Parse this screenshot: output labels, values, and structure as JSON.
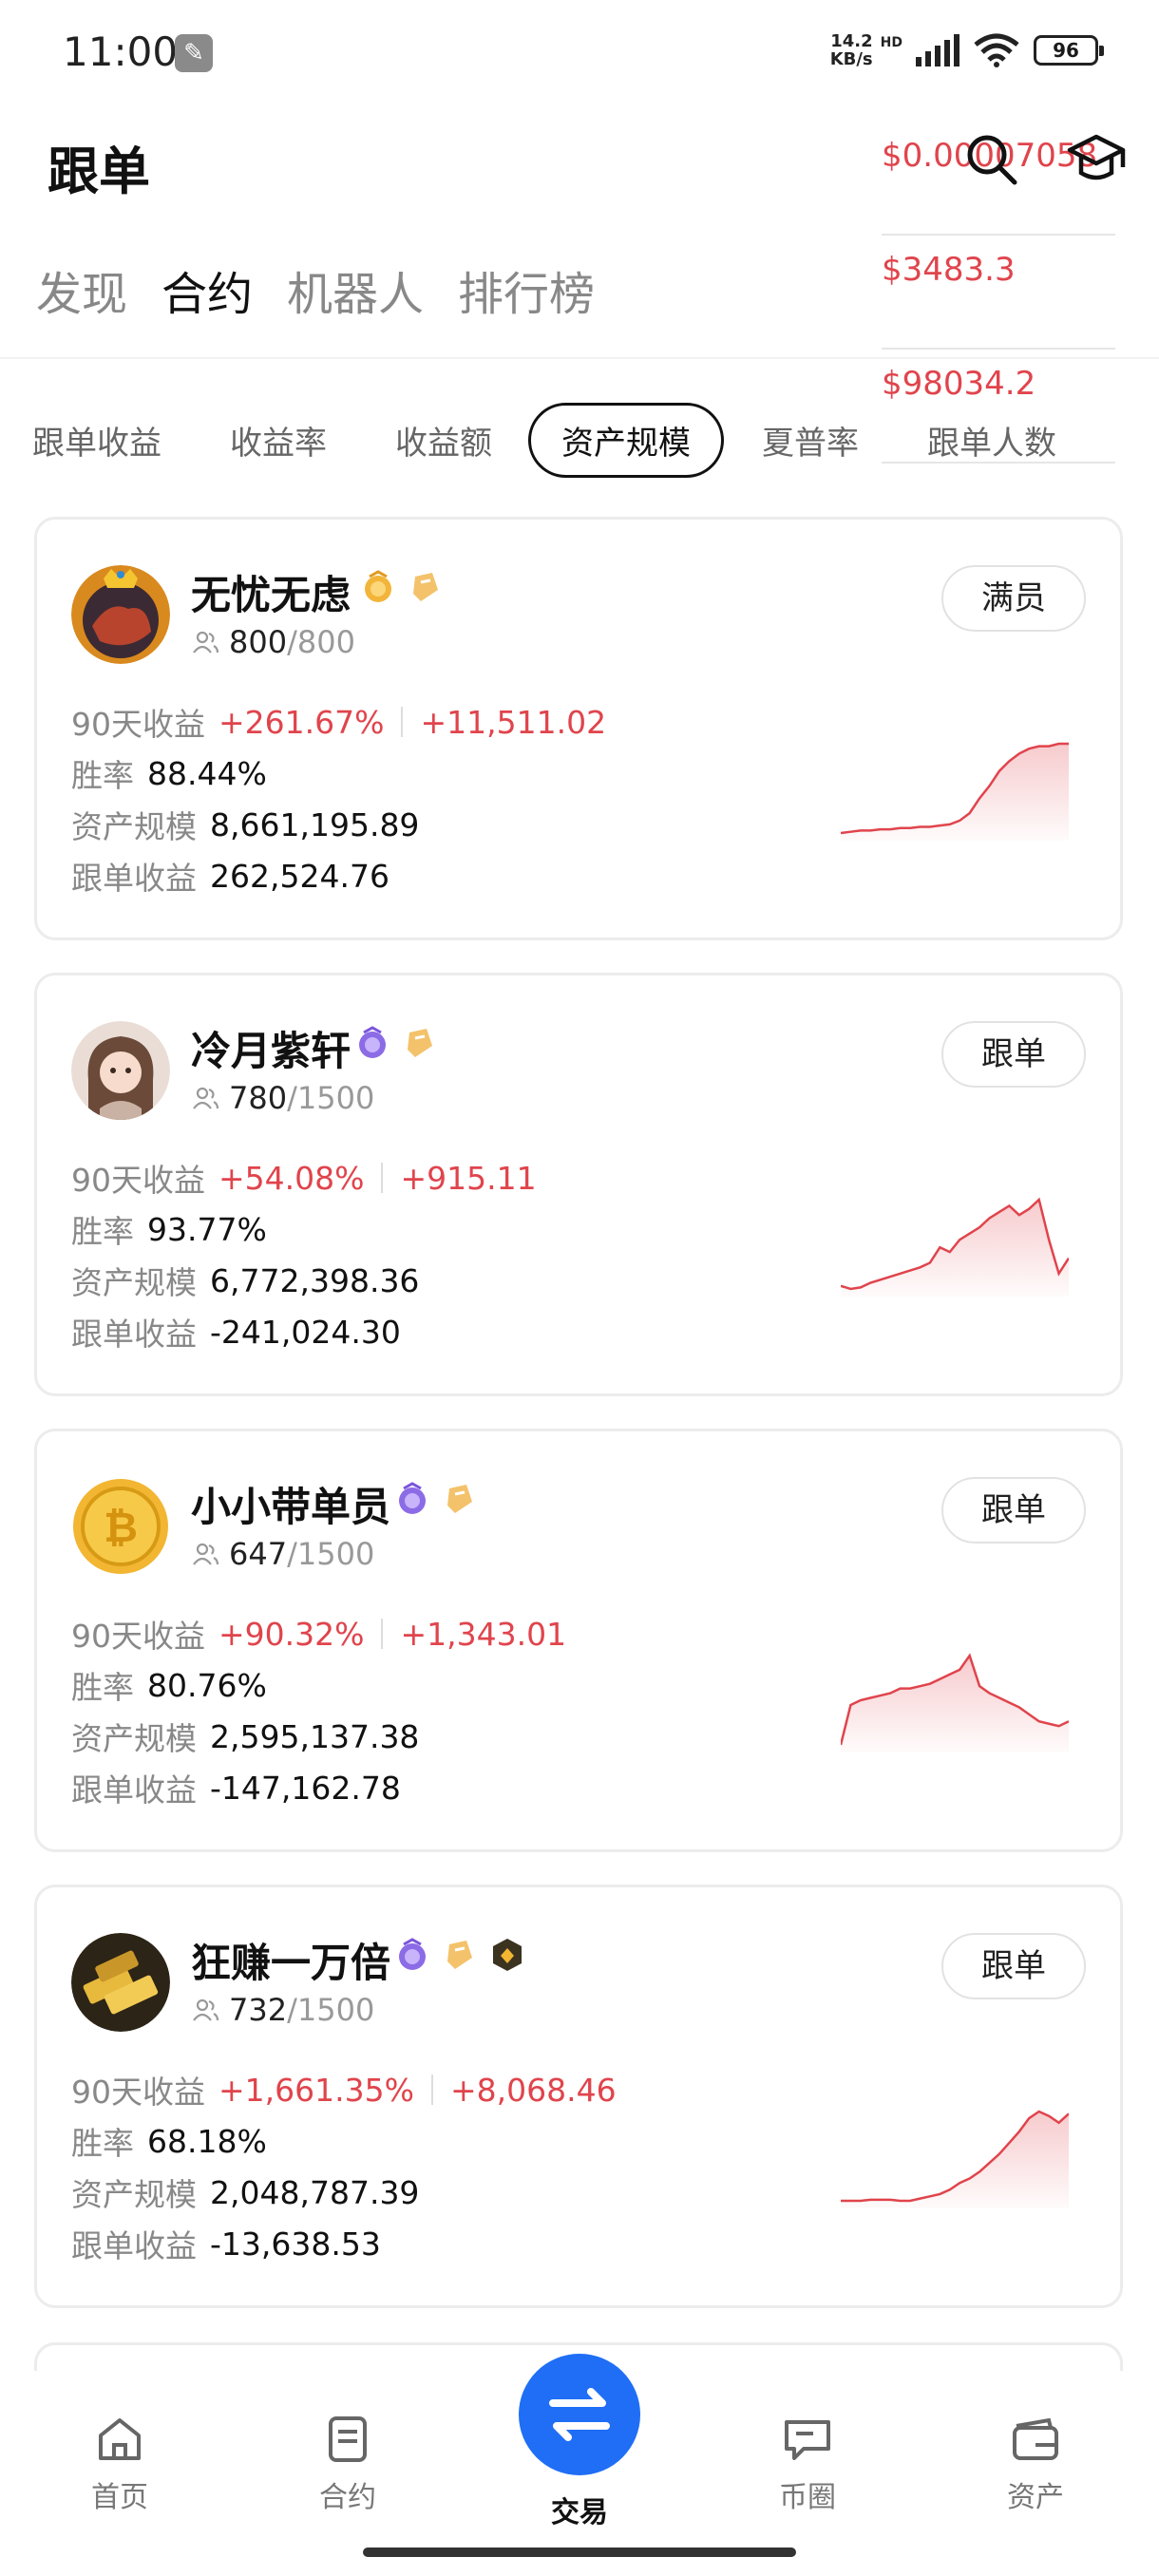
{
  "status_bar": {
    "time": "11:00",
    "net_speed": "14.2",
    "net_unit": "KB/s",
    "hd": "HD",
    "battery": "96"
  },
  "header": {
    "title": "跟单"
  },
  "ticker_prices": [
    "$0.00007058",
    "$3483.3",
    "$98034.2"
  ],
  "main_tabs": [
    {
      "label": "发现",
      "active": false
    },
    {
      "label": "合约",
      "active": true
    },
    {
      "label": "机器人",
      "active": false
    },
    {
      "label": "排行榜",
      "active": false
    }
  ],
  "sort_chips": [
    {
      "label": "跟单收益",
      "active": false
    },
    {
      "label": "收益率",
      "active": false
    },
    {
      "label": "收益额",
      "active": false
    },
    {
      "label": "资产规模",
      "active": true
    },
    {
      "label": "夏普率",
      "active": false
    },
    {
      "label": "跟单人数",
      "active": false
    }
  ],
  "labels": {
    "ret90": "90天收益",
    "winrate": "胜率",
    "aum": "资产规模",
    "follow_pnl": "跟单收益"
  },
  "traders": [
    {
      "name": "无忧无虑",
      "followers": "800",
      "capacity": "/800",
      "button": "满员",
      "ret90_pct": "+261.67%",
      "ret90_amt": "+11,511.02",
      "winrate": "88.44%",
      "aum": "8,661,195.89",
      "follow_pnl": "262,524.76",
      "spark": [
        2,
        3,
        4,
        4,
        5,
        5,
        6,
        6,
        7,
        7,
        8,
        9,
        12,
        18,
        30,
        40,
        52,
        60,
        66,
        70,
        72,
        72,
        74,
        74
      ]
    },
    {
      "name": "冷月紫轩",
      "followers": "780",
      "capacity": "/1500",
      "button": "跟单",
      "ret90_pct": "+54.08%",
      "ret90_amt": "+915.11",
      "winrate": "93.77%",
      "aum": "6,772,398.36",
      "follow_pnl": "-241,024.30",
      "spark": [
        10,
        8,
        9,
        12,
        14,
        16,
        18,
        20,
        22,
        25,
        35,
        32,
        40,
        44,
        48,
        54,
        58,
        62,
        56,
        60,
        66,
        40,
        18,
        28
      ]
    },
    {
      "name": "小小带单员",
      "followers": "647",
      "capacity": "/1500",
      "button": "跟单",
      "ret90_pct": "+90.32%",
      "ret90_amt": "+1,343.01",
      "winrate": "80.76%",
      "aum": "2,595,137.38",
      "follow_pnl": "-147,162.78",
      "spark": [
        10,
        44,
        48,
        50,
        52,
        54,
        58,
        58,
        60,
        62,
        66,
        70,
        74,
        86,
        60,
        54,
        50,
        46,
        42,
        36,
        30,
        28,
        26,
        30
      ]
    },
    {
      "name": "狂赚一万倍",
      "followers": "732",
      "capacity": "/1500",
      "button": "跟单",
      "ret90_pct": "+1,661.35%",
      "ret90_amt": "+8,068.46",
      "winrate": "68.18%",
      "aum": "2,048,787.39",
      "follow_pnl": "-13,638.53",
      "spark": [
        4,
        4,
        4,
        5,
        5,
        5,
        4,
        4,
        6,
        8,
        10,
        14,
        20,
        24,
        30,
        38,
        46,
        56,
        66,
        78,
        84,
        80,
        74,
        82
      ]
    }
  ],
  "bottom_nav": [
    {
      "label": "首页",
      "icon": "home-icon"
    },
    {
      "label": "合约",
      "icon": "contract-icon"
    },
    {
      "label": "交易",
      "icon": "trade-swap-icon"
    },
    {
      "label": "币圈",
      "icon": "community-icon"
    },
    {
      "label": "资产",
      "icon": "wallet-icon"
    }
  ],
  "colors": {
    "accent": "#1f6ef5",
    "up": "#e0444c",
    "down": "#1ba27a"
  }
}
